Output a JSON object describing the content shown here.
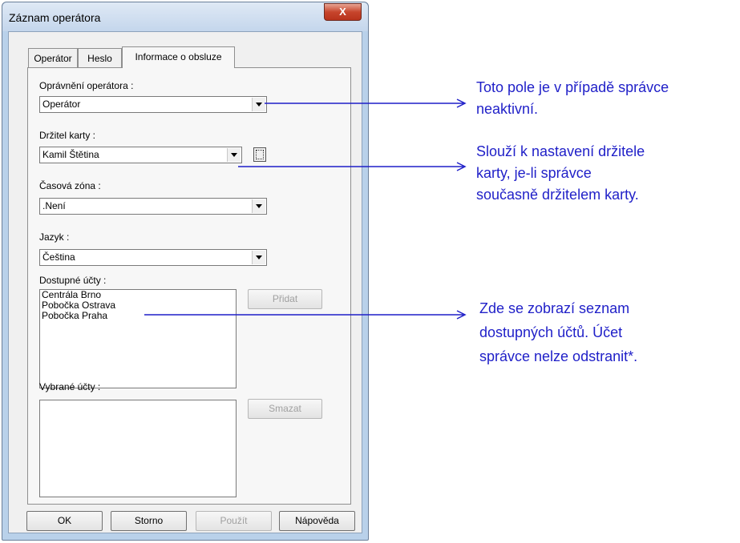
{
  "window": {
    "title": "Záznam operátora",
    "close_glyph": "X"
  },
  "tabs": [
    {
      "label": "Operátor"
    },
    {
      "label": "Heslo"
    },
    {
      "label": "Informace o obsluze",
      "active": true
    }
  ],
  "form": {
    "operator_permission": {
      "label": "Oprávnění operátora :",
      "value": "Operátor"
    },
    "card_holder": {
      "label": "Držitel karty :",
      "value": "Kamil Štětina"
    },
    "time_zone": {
      "label": "Časová zóna :",
      "value": ".Není"
    },
    "language": {
      "label": "Jazyk :",
      "value": "Čeština"
    },
    "available_accounts": {
      "label": "Dostupné účty :",
      "items": [
        "Centrála Brno",
        "Pobočka Ostrava",
        "Pobočka Praha"
      ]
    },
    "selected_accounts": {
      "label": "Vybrané účty :",
      "items": []
    },
    "add_button": "Přidat",
    "delete_button": "Smazat"
  },
  "footer": {
    "ok": "OK",
    "cancel": "Storno",
    "apply": "Použít",
    "help": "Nápověda"
  },
  "annotations": [
    {
      "lines": [
        "Toto pole je v případě správce",
        "neaktivní."
      ]
    },
    {
      "lines": [
        "Slouží k nastavení držitele",
        "karty, je-li správce",
        "současně držitelem karty."
      ]
    },
    {
      "lines": [
        "Zde se zobrazí seznam",
        "dostupných účtů. Účet",
        "správce nelze odstranit*."
      ]
    }
  ],
  "colors": {
    "annotation": "#1f1fc8",
    "title_bar": "#c4d6ec",
    "close_button": "#c7452c"
  }
}
